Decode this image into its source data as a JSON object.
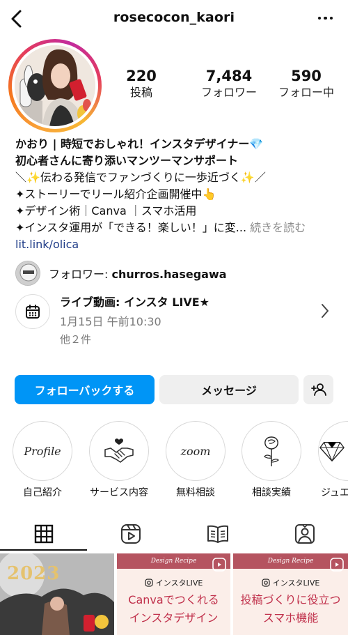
{
  "header": {
    "username": "rosecocon_kaori"
  },
  "stats": {
    "posts": {
      "value": "220",
      "label": "投稿"
    },
    "followers": {
      "value": "7,484",
      "label": "フォロワー"
    },
    "following": {
      "value": "590",
      "label": "フォロー中"
    }
  },
  "bio": {
    "line1": "かおり | 時短でおしゃれ！インスタデザイナー💎",
    "line2": "初心者さんに寄り添いマンツーマンサポート",
    "line3": "＼✨伝わる発信でファンづくりに一歩近づく✨／",
    "line4": "✦ストーリーでリール紹介企画開催中👆",
    "line5": "✦デザイン術｜Canva ｜スマホ活用",
    "line6": "✦インスタ運用が「できる！楽しい！」に変...",
    "more_label": "続きを読む",
    "link": "lit.link/olica"
  },
  "followed_by": {
    "prefix": "フォロワー: ",
    "name": "churros.hasegawa"
  },
  "event": {
    "title": "ライブ動画: インスタ LIVE★",
    "time": "1月15日 午前10:30",
    "others": "他２件"
  },
  "buttons": {
    "follow_back": "フォローバックする",
    "message": "メッセージ"
  },
  "highlights": [
    {
      "label": "自己紹介",
      "cover_text": "Profile"
    },
    {
      "label": "サービス内容",
      "cover_text": ""
    },
    {
      "label": "無料相談",
      "cover_text": "zoom"
    },
    {
      "label": "相談実績",
      "cover_text": ""
    },
    {
      "label": "ジュエ",
      "cover_text": ""
    }
  ],
  "posts": [
    {
      "type": "image",
      "overlay_text": "2023"
    },
    {
      "type": "reel",
      "recipe": "Design Recipe",
      "tag": "インスタLIVE",
      "title1": "Canvaでつくれる",
      "title2": "インスタデザイン"
    },
    {
      "type": "reel",
      "recipe": "Design Recipe",
      "tag": "インスタLIVE",
      "title1": "投稿づくりに役立つ",
      "title2": "スマホ機能"
    }
  ],
  "colors": {
    "accent_blue": "#0095f6",
    "button_gray": "#efefef",
    "link_blue": "#1f3c88",
    "muted_text": "#7b7b7b",
    "recipe_red": "#c0304b"
  },
  "icons": {
    "back": "chevron-left-icon",
    "more": "more-horizontal-icon",
    "calendar": "calendar-icon",
    "chevron": "chevron-right-icon",
    "add_user": "add-user-icon",
    "grid": "grid-icon",
    "reels": "reels-icon",
    "guide": "guide-book-icon",
    "tagged": "tagged-person-icon"
  }
}
